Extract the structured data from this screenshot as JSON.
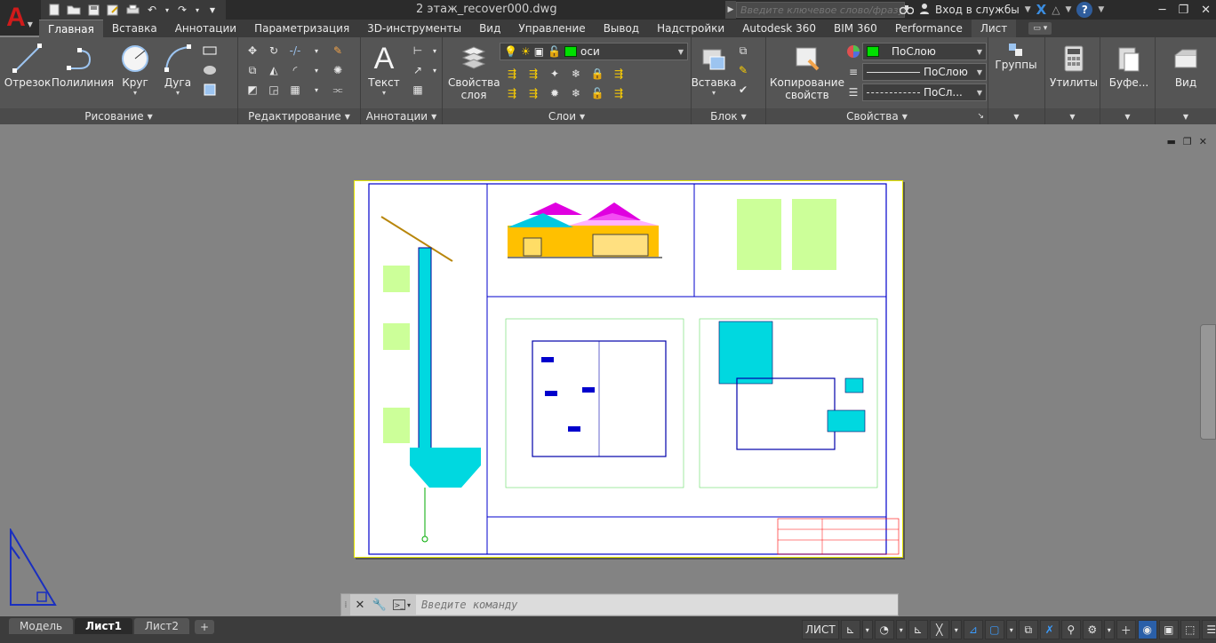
{
  "title": {
    "app_letter": "A",
    "document": "2 этаж_recover000.dwg",
    "search_placeholder": "Введите ключевое слово/фразу",
    "signin": "Вход в службы",
    "help": "?"
  },
  "tabs": [
    "Главная",
    "Вставка",
    "Аннотации",
    "Параметризация",
    "3D-инструменты",
    "Вид",
    "Управление",
    "Вывод",
    "Надстройки",
    "Autodesk 360",
    "BIM 360",
    "Performance",
    "Лист"
  ],
  "ribbon": {
    "draw": {
      "title": "Рисование",
      "line": "Отрезок",
      "polyline": "Полилиния",
      "circle": "Круг",
      "arc": "Дуга"
    },
    "modify": {
      "title": "Редактирование"
    },
    "annotation": {
      "title": "Аннотации",
      "text": "Текст"
    },
    "layers": {
      "title": "Слои",
      "properties": "Свойства слоя",
      "current_layer": "оси"
    },
    "block": {
      "title": "Блок",
      "insert": "Вставка"
    },
    "properties": {
      "title": "Свойства",
      "match": "Копирование свойств",
      "color": "ПоСлою",
      "linetype": "ПоСлою",
      "lineweight": "ПоСл..."
    },
    "groups": "Группы",
    "utilities": "Утилиты",
    "clipboard": "Буфе...",
    "view": "Вид"
  },
  "command": {
    "placeholder": "Введите команду"
  },
  "layout_tabs": [
    "Модель",
    "Лист1",
    "Лист2"
  ],
  "active_layout": "Лист1",
  "status": {
    "space": "ЛИСТ"
  },
  "colors": {
    "accent": "#2a5fa8",
    "layer_green": "#00e000",
    "sheet_border": "#e6e600",
    "drawing_blue": "#0000cc"
  }
}
